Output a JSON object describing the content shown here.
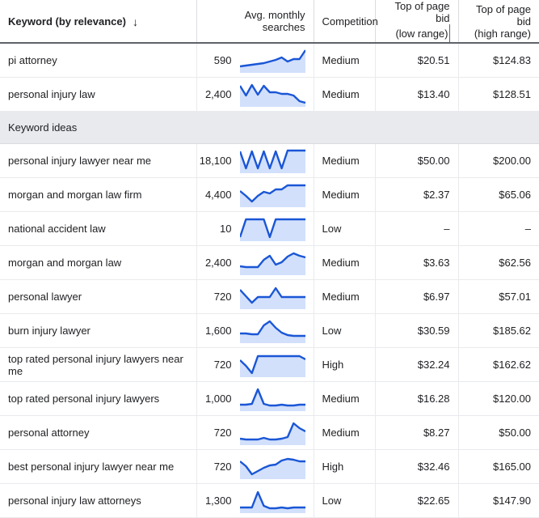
{
  "table": {
    "columns": [
      {
        "key": "keyword",
        "label": "Keyword (by relevance)",
        "sort_icon": "↓",
        "sorted": true
      },
      {
        "key": "searches",
        "label": "Avg. monthly searches"
      },
      {
        "key": "competition",
        "label": "Competition"
      },
      {
        "key": "bid_low_line1",
        "label": "Top of page bid",
        "label_line2": "(low range)"
      },
      {
        "key": "bid_high_line1",
        "label": "Top of page bid",
        "label_line2": "(high range)"
      }
    ],
    "header": {
      "keyword": "Keyword (by relevance)",
      "sort_arrow": "↓",
      "searches": "Avg. monthly searches",
      "competition": "Competition",
      "bid_low_l1": "Top of page bid",
      "bid_low_l2": "(low range)",
      "bid_high_l1": "Top of page bid",
      "bid_high_l2": "(high range)"
    },
    "section_label": "Keyword ideas",
    "selected_rows": [
      {
        "keyword": "pi attorney",
        "searches": "590",
        "competition": "Medium",
        "bid_low": "$20.51",
        "bid_high": "$124.83",
        "trend": [
          22,
          21,
          20,
          19,
          18,
          16,
          14,
          11,
          16,
          13,
          13,
          2
        ]
      },
      {
        "keyword": "personal injury law",
        "searches": "2,400",
        "competition": "Medium",
        "bid_low": "$13.40",
        "bid_high": "$128.51",
        "trend": [
          4,
          16,
          3,
          15,
          4,
          12,
          12,
          14,
          14,
          16,
          23,
          25
        ]
      }
    ],
    "idea_rows": [
      {
        "keyword": "personal injury lawyer near me",
        "searches": "18,100",
        "competition": "Medium",
        "bid_low": "$50.00",
        "bid_high": "$200.00",
        "trend": [
          3,
          24,
          3,
          24,
          3,
          24,
          3,
          24,
          2,
          2,
          2,
          2
        ]
      },
      {
        "keyword": "morgan and morgan law firm",
        "searches": "4,400",
        "competition": "Medium",
        "bid_low": "$2.37",
        "bid_high": "$65.06",
        "trend": [
          10,
          16,
          23,
          16,
          11,
          13,
          8,
          8,
          3,
          3,
          3,
          3
        ]
      },
      {
        "keyword": "national accident law",
        "searches": "10",
        "competition": "Low",
        "bid_low": "–",
        "bid_high": "–",
        "trend": [
          25,
          3,
          3,
          3,
          3,
          25,
          3,
          3,
          3,
          3,
          3,
          3
        ]
      },
      {
        "keyword": "morgan and morgan law",
        "searches": "2,400",
        "competition": "Medium",
        "bid_low": "$3.63",
        "bid_high": "$62.56",
        "trend": [
          19,
          20,
          20,
          20,
          11,
          6,
          17,
          14,
          7,
          3,
          6,
          8
        ]
      },
      {
        "keyword": "personal lawyer",
        "searches": "720",
        "competition": "Medium",
        "bid_low": "$6.97",
        "bid_high": "$57.01",
        "trend": [
          6,
          14,
          22,
          15,
          15,
          15,
          4,
          15,
          15,
          15,
          15,
          15
        ]
      },
      {
        "keyword": "burn injury lawyer",
        "searches": "1,600",
        "competition": "Low",
        "bid_low": "$30.59",
        "bid_high": "$185.62",
        "trend": [
          18,
          18,
          19,
          19,
          8,
          3,
          11,
          17,
          20,
          21,
          21,
          21
        ]
      },
      {
        "keyword": "top rated personal injury lawyers near me",
        "searches": "720",
        "competition": "High",
        "bid_low": "$32.24",
        "bid_high": "$162.62",
        "trend": [
          9,
          16,
          25,
          4,
          4,
          4,
          4,
          4,
          4,
          4,
          4,
          8
        ]
      },
      {
        "keyword": "top rated personal injury lawyers",
        "searches": "1,000",
        "competition": "Medium",
        "bid_low": "$16.28",
        "bid_high": "$120.00",
        "trend": [
          22,
          22,
          21,
          3,
          21,
          23,
          23,
          22,
          23,
          23,
          22,
          22
        ]
      },
      {
        "keyword": "personal attorney",
        "searches": "720",
        "competition": "Medium",
        "bid_low": "$8.27",
        "bid_high": "$50.00",
        "trend": [
          22,
          23,
          23,
          23,
          21,
          23,
          23,
          22,
          20,
          3,
          9,
          13
        ]
      },
      {
        "keyword": "best personal injury lawyer near me",
        "searches": "720",
        "competition": "High",
        "bid_low": "$32.46",
        "bid_high": "$165.00",
        "trend": [
          8,
          14,
          24,
          20,
          16,
          13,
          12,
          7,
          5,
          6,
          8,
          8
        ]
      },
      {
        "keyword": "personal injury law attorneys",
        "searches": "1,300",
        "competition": "Low",
        "bid_low": "$22.65",
        "bid_high": "$147.90",
        "trend": [
          23,
          23,
          23,
          4,
          21,
          24,
          24,
          23,
          24,
          23,
          23,
          23
        ]
      }
    ]
  },
  "colors": {
    "spark_line": "#1a56d6",
    "spark_fill": "#d2e0fb",
    "section_bg": "#e8eaed",
    "text": "#202124",
    "grid": "#e8eaed",
    "header_rule": "#5f6368"
  }
}
